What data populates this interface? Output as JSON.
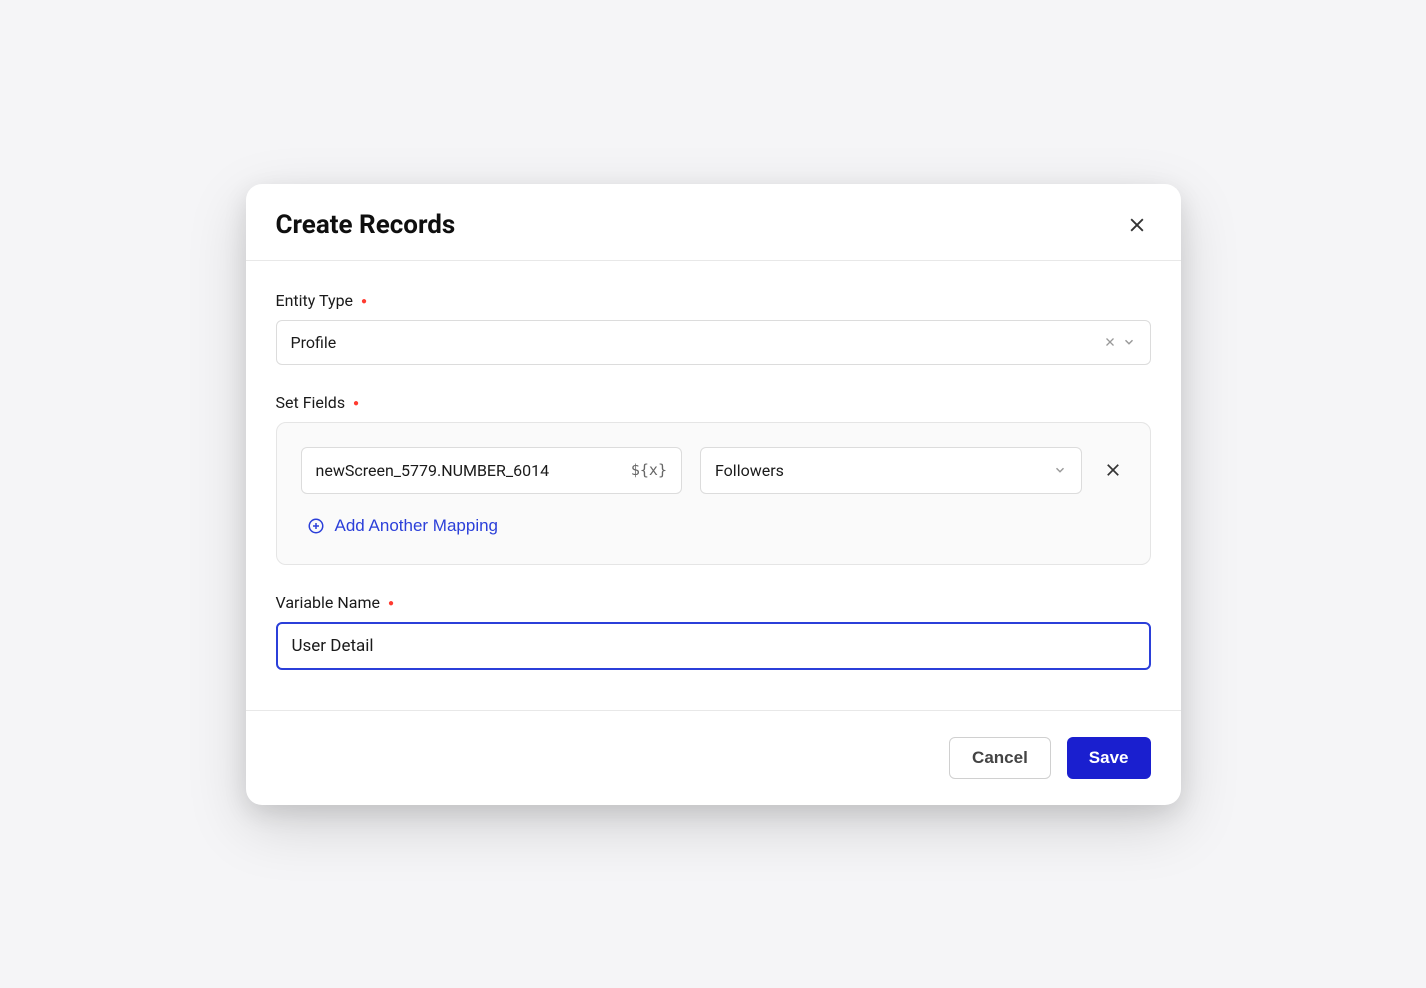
{
  "modal": {
    "title": "Create Records",
    "entity_type": {
      "label": "Entity Type",
      "value": "Profile"
    },
    "set_fields": {
      "label": "Set Fields",
      "mappings": [
        {
          "source": "newScreen_5779.NUMBER_6014",
          "target": "Followers"
        }
      ],
      "add_button_label": "Add Another Mapping",
      "var_hint": "${x}"
    },
    "variable_name": {
      "label": "Variable Name",
      "value": "User Detail"
    },
    "footer": {
      "cancel_label": "Cancel",
      "save_label": "Save"
    }
  }
}
